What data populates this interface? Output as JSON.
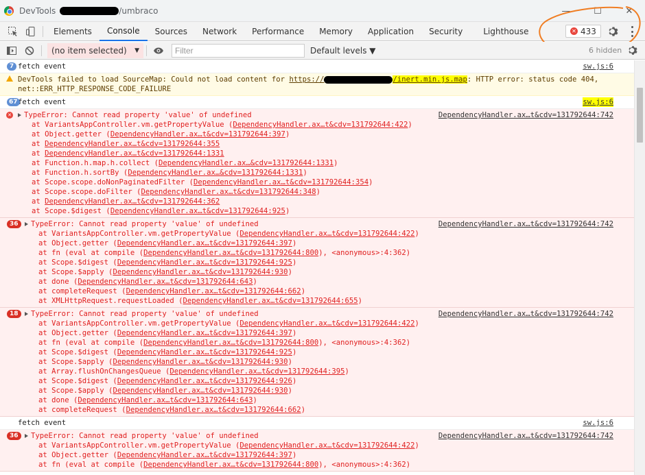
{
  "window": {
    "title_prefix": "DevTools",
    "title_suffix": "/umbraco",
    "minimize": "—",
    "maximize": "☐",
    "close": "✕"
  },
  "toolbar": {
    "tabs": [
      "Elements",
      "Console",
      "Sources",
      "Network",
      "Performance",
      "Memory",
      "Application",
      "Security",
      "Lighthouse"
    ],
    "active_tab": "Console",
    "error_count": "433"
  },
  "console_toolbar": {
    "context": "(no item selected)",
    "filter_placeholder": "Filter",
    "levels": "Default levels ▼",
    "hidden": "6 hidden"
  },
  "colors": {
    "accent": "#1a73e8",
    "error_text": "#e02020",
    "error_bg": "#fff0f0",
    "warn_bg": "#fffbe5",
    "annotation_orange": "#f07d22",
    "highlight": "#ffff00"
  },
  "messages": [
    {
      "type": "info",
      "count": "7",
      "text": "fetch event",
      "source": "sw.js:6"
    },
    {
      "type": "warn",
      "text_a": "DevTools failed to load SourceMap: Could not load content for ",
      "url_a": "https://",
      "url_b": "/inert.min.js.map",
      "text_b": ": HTTP error: status code 404,",
      "text_c": "net::ERR_HTTP_RESPONSE_CODE_FAILURE"
    },
    {
      "type": "info",
      "count": "67",
      "text": "fetch event",
      "source": "sw.js:6"
    },
    {
      "type": "error",
      "count": "",
      "text": "TypeError: Cannot read property 'value' of undefined",
      "source": "DependencyHandler.ax…t&cdv=131792644:742",
      "frames": [
        {
          "fn": "at VariantsAppController.vm.getPropertyValue (",
          "loc": "DependencyHandler.ax…t&cdv=131792644:422",
          "tail": ")"
        },
        {
          "fn": "at Object.getter (",
          "loc": "DependencyHandler.ax…t&cdv=131792644:397",
          "tail": ")"
        },
        {
          "fn": "at ",
          "loc": "DependencyHandler.ax…t&cdv=131792644:355",
          "tail": ""
        },
        {
          "fn": "at ",
          "loc": "DependencyHandler.ax…t&cdv=131792644:1331",
          "tail": ""
        },
        {
          "fn": "at Function.h.map.h.collect (",
          "loc": "DependencyHandler.ax…&cdv=131792644:1331",
          "tail": ")"
        },
        {
          "fn": "at Function.h.sortBy (",
          "loc": "DependencyHandler.ax…&cdv=131792644:1331",
          "tail": ")"
        },
        {
          "fn": "at Scope.scope.doNonPaginatedFilter (",
          "loc": "DependencyHandler.ax…t&cdv=131792644:354",
          "tail": ")"
        },
        {
          "fn": "at Scope.scope.doFilter (",
          "loc": "DependencyHandler.ax…t&cdv=131792644:348",
          "tail": ")"
        },
        {
          "fn": "at ",
          "loc": "DependencyHandler.ax…t&cdv=131792644:362",
          "tail": ""
        },
        {
          "fn": "at Scope.$digest (",
          "loc": "DependencyHandler.ax…t&cdv=131792644:925",
          "tail": ")"
        }
      ]
    },
    {
      "type": "error",
      "count": "36",
      "text": "TypeError: Cannot read property 'value' of undefined",
      "source": "DependencyHandler.ax…t&cdv=131792644:742",
      "frames": [
        {
          "fn": "at VariantsAppController.vm.getPropertyValue (",
          "loc": "DependencyHandler.ax…t&cdv=131792644:422",
          "tail": ")"
        },
        {
          "fn": "at Object.getter (",
          "loc": "DependencyHandler.ax…t&cdv=131792644:397",
          "tail": ")"
        },
        {
          "fn": "at fn (eval at compile (",
          "loc": "DependencyHandler.ax…t&cdv=131792644:800",
          "tail": "), <anonymous>:4:362)"
        },
        {
          "fn": "at Scope.$digest (",
          "loc": "DependencyHandler.ax…t&cdv=131792644:925",
          "tail": ")"
        },
        {
          "fn": "at Scope.$apply (",
          "loc": "DependencyHandler.ax…t&cdv=131792644:930",
          "tail": ")"
        },
        {
          "fn": "at done (",
          "loc": "DependencyHandler.ax…t&cdv=131792644:643",
          "tail": ")"
        },
        {
          "fn": "at completeRequest (",
          "loc": "DependencyHandler.ax…t&cdv=131792644:662",
          "tail": ")"
        },
        {
          "fn": "at XMLHttpRequest.requestLoaded (",
          "loc": "DependencyHandler.ax…t&cdv=131792644:655",
          "tail": ")"
        }
      ]
    },
    {
      "type": "error",
      "count": "18",
      "text": "TypeError: Cannot read property 'value' of undefined",
      "source": "DependencyHandler.ax…t&cdv=131792644:742",
      "frames": [
        {
          "fn": "at VariantsAppController.vm.getPropertyValue (",
          "loc": "DependencyHandler.ax…t&cdv=131792644:422",
          "tail": ")"
        },
        {
          "fn": "at Object.getter (",
          "loc": "DependencyHandler.ax…t&cdv=131792644:397",
          "tail": ")"
        },
        {
          "fn": "at fn (eval at compile (",
          "loc": "DependencyHandler.ax…t&cdv=131792644:800",
          "tail": "), <anonymous>:4:362)"
        },
        {
          "fn": "at Scope.$digest (",
          "loc": "DependencyHandler.ax…t&cdv=131792644:925",
          "tail": ")"
        },
        {
          "fn": "at Scope.$apply (",
          "loc": "DependencyHandler.ax…t&cdv=131792644:930",
          "tail": ")"
        },
        {
          "fn": "at Array.flushOnChangesQueue (",
          "loc": "DependencyHandler.ax…t&cdv=131792644:395",
          "tail": ")"
        },
        {
          "fn": "at Scope.$digest (",
          "loc": "DependencyHandler.ax…t&cdv=131792644:926",
          "tail": ")"
        },
        {
          "fn": "at Scope.$apply (",
          "loc": "DependencyHandler.ax…t&cdv=131792644:930",
          "tail": ")"
        },
        {
          "fn": "at done (",
          "loc": "DependencyHandler.ax…t&cdv=131792644:643",
          "tail": ")"
        },
        {
          "fn": "at completeRequest (",
          "loc": "DependencyHandler.ax…t&cdv=131792644:662",
          "tail": ")"
        }
      ]
    },
    {
      "type": "info",
      "count": "",
      "text": "fetch event",
      "source": "sw.js:6"
    },
    {
      "type": "error",
      "count": "36",
      "text": "TypeError: Cannot read property 'value' of undefined",
      "source": "DependencyHandler.ax…t&cdv=131792644:742",
      "frames": [
        {
          "fn": "at VariantsAppController.vm.getPropertyValue (",
          "loc": "DependencyHandler.ax…t&cdv=131792644:422",
          "tail": ")"
        },
        {
          "fn": "at Object.getter (",
          "loc": "DependencyHandler.ax…t&cdv=131792644:397",
          "tail": ")"
        },
        {
          "fn": "at fn (eval at compile (",
          "loc": "DependencyHandler.ax…t&cdv=131792644:800",
          "tail": "), <anonymous>:4:362)"
        }
      ]
    }
  ]
}
